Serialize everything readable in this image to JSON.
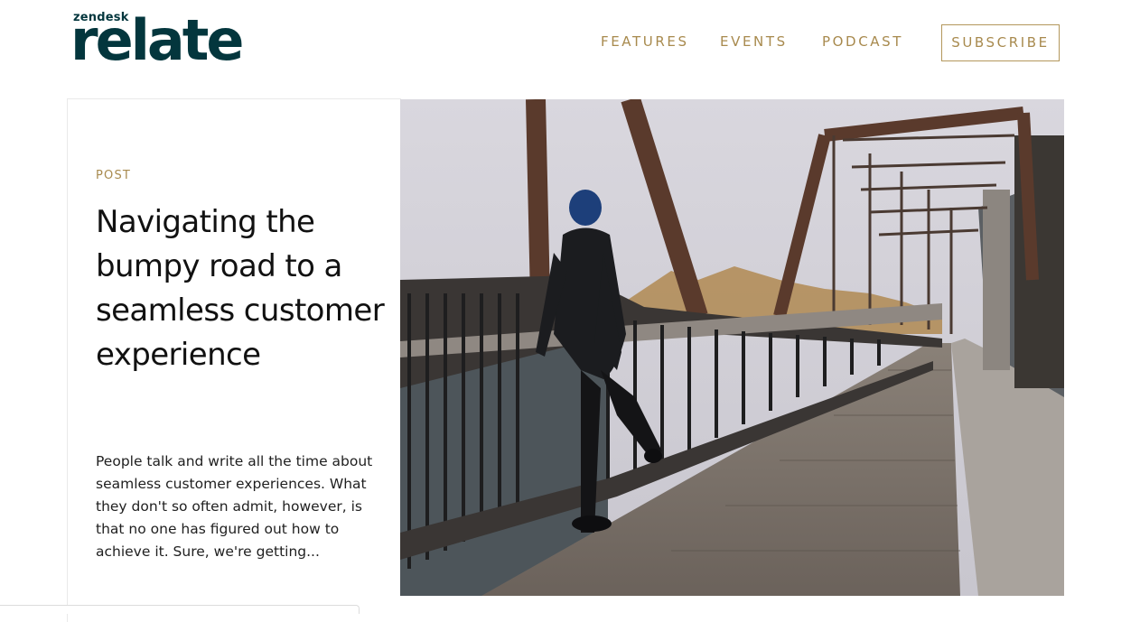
{
  "brand": {
    "small": "zendesk",
    "big": "relate",
    "color": "#03363d"
  },
  "nav": {
    "features": "FEATURES",
    "events": "EVENTS",
    "podcast": "PODCAST",
    "subscribe": "SUBSCRIBE",
    "accent": "#a88a4e"
  },
  "article": {
    "label": "POST",
    "title": "Navigating the bumpy road to a seamless customer experience",
    "excerpt": "People talk and write all the time about seamless customer experiences. What they don't so often admit, however, is that no one has figured out how to achieve it. Sure, we're getting..."
  },
  "hero_image": {
    "subject": "runner stretching on a steel truss bridge with wooden deck"
  }
}
